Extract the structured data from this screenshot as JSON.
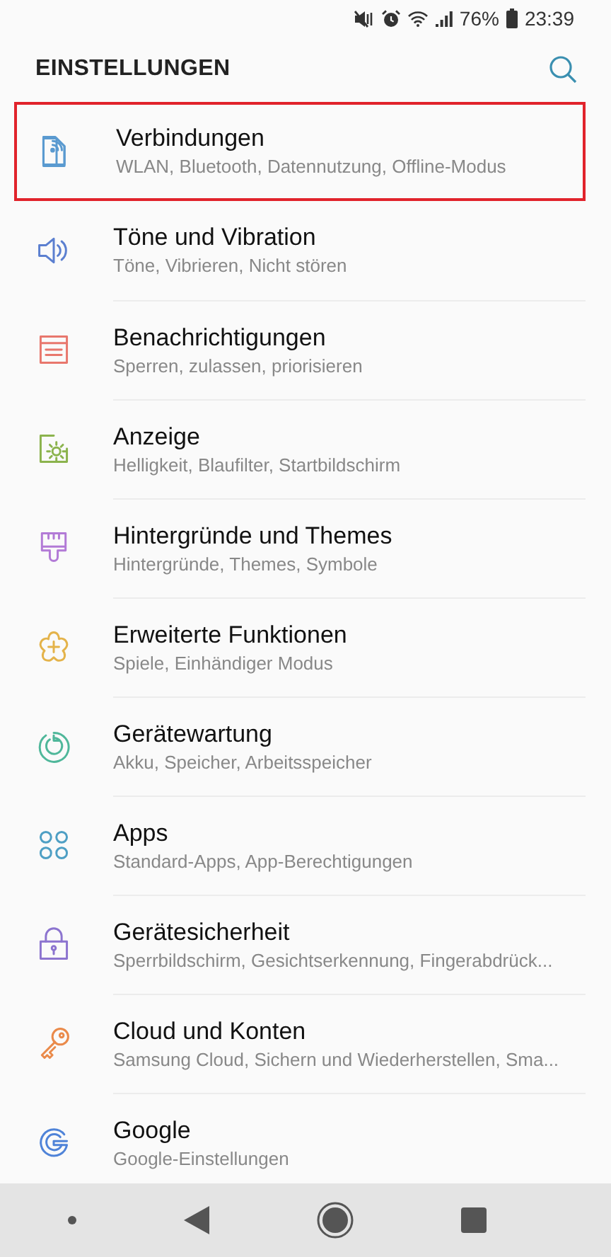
{
  "status_bar": {
    "battery_percent": "76%",
    "time": "23:39"
  },
  "header": {
    "title": "EINSTELLUNGEN"
  },
  "items": [
    {
      "title": "Verbindungen",
      "subtitle": "WLAN, Bluetooth, Datennutzung, Offline-Modus",
      "highlighted": true
    },
    {
      "title": "Töne und Vibration",
      "subtitle": "Töne, Vibrieren, Nicht stören",
      "highlighted": false
    },
    {
      "title": "Benachrichtigungen",
      "subtitle": "Sperren, zulassen, priorisieren",
      "highlighted": false
    },
    {
      "title": "Anzeige",
      "subtitle": "Helligkeit, Blaufilter, Startbildschirm",
      "highlighted": false
    },
    {
      "title": "Hintergründe und Themes",
      "subtitle": "Hintergründe, Themes, Symbole",
      "highlighted": false
    },
    {
      "title": "Erweiterte Funktionen",
      "subtitle": "Spiele, Einhändiger Modus",
      "highlighted": false
    },
    {
      "title": "Gerätewartung",
      "subtitle": "Akku, Speicher, Arbeitsspeicher",
      "highlighted": false
    },
    {
      "title": "Apps",
      "subtitle": "Standard-Apps, App-Berechtigungen",
      "highlighted": false
    },
    {
      "title": "Gerätesicherheit",
      "subtitle": "Sperrbildschirm, Gesichtserkennung, Fingerabdrück...",
      "highlighted": false
    },
    {
      "title": "Cloud und Konten",
      "subtitle": "Samsung Cloud, Sichern und Wiederherstellen, Sma...",
      "highlighted": false
    },
    {
      "title": "Google",
      "subtitle": "Google-Einstellungen",
      "highlighted": false
    }
  ]
}
